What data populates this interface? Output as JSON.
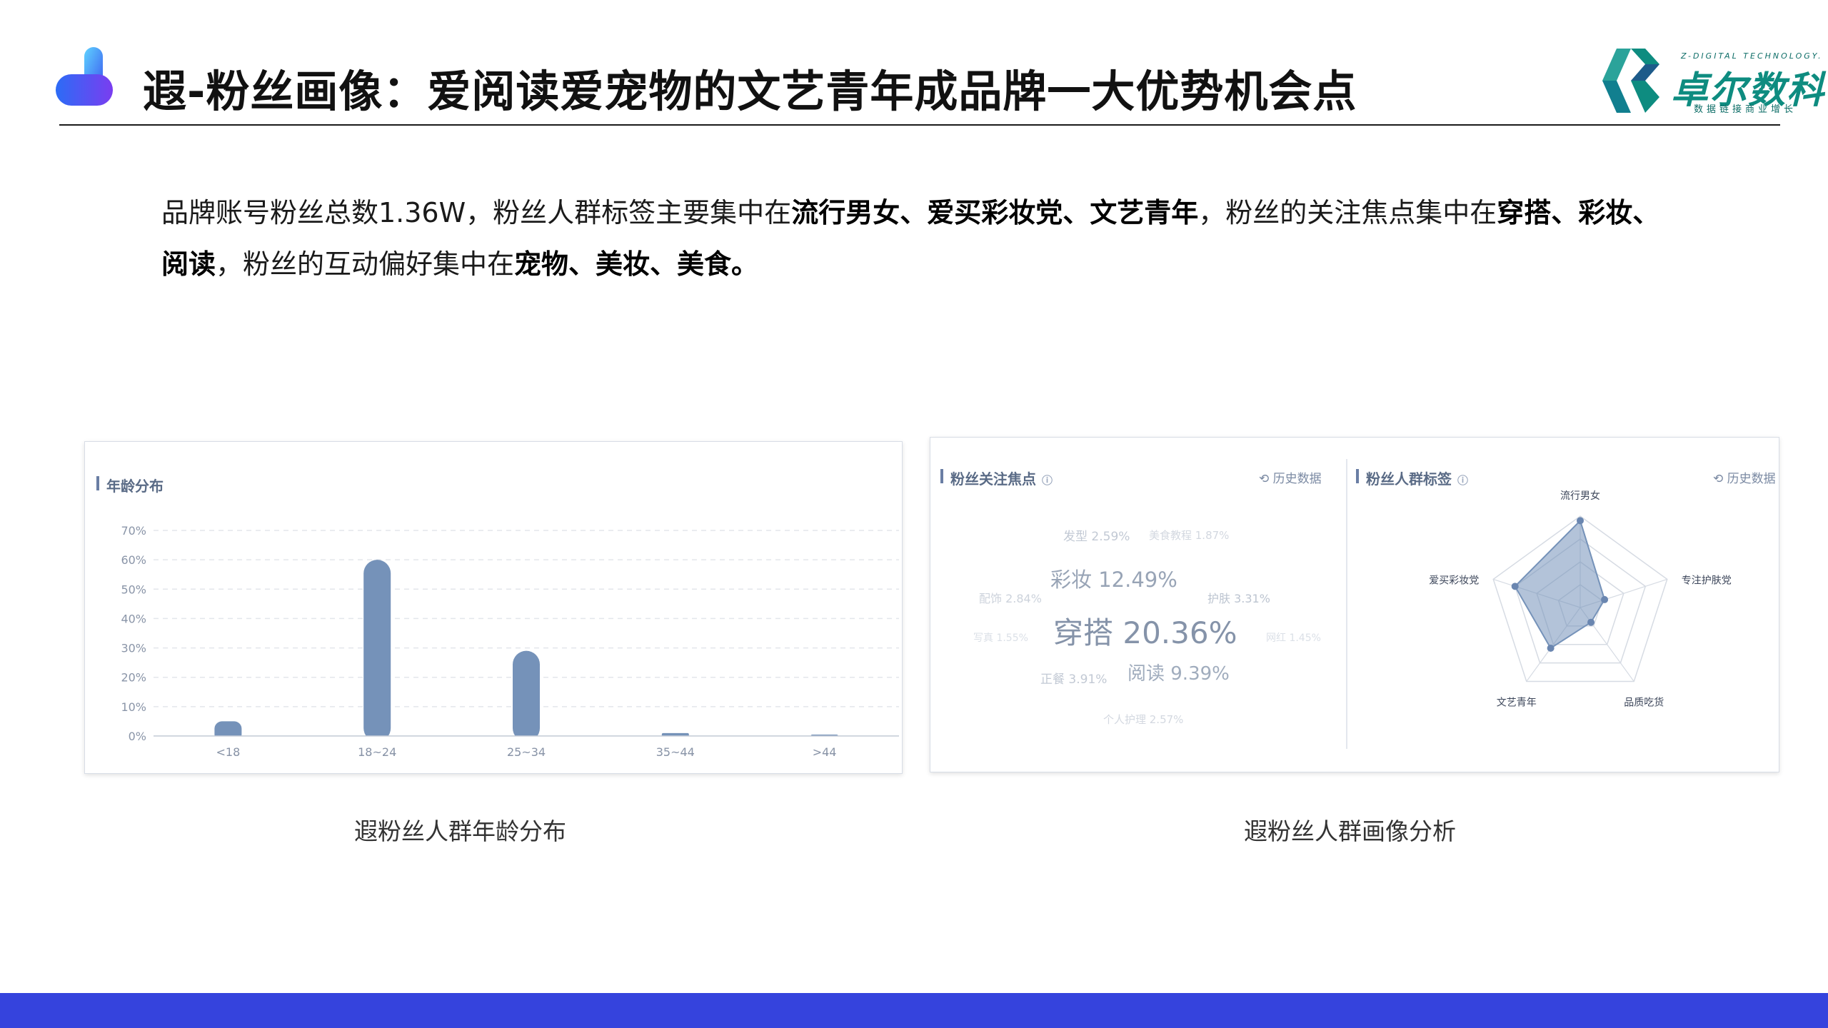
{
  "header": {
    "title": "遐-粉丝画像：爱阅读爱宠物的文艺青年成品牌一大优势机会点",
    "brand": {
      "tagline": "Z-DIGITAL TECHNOLOGY.",
      "name": "卓尔数科",
      "slogan": "数据链接商业增长"
    }
  },
  "description": {
    "s1": "品牌账号粉丝总数1.36W，粉丝人群标签主要集中在",
    "b1": "流行男女、爱买彩妆党、文艺青年",
    "s2": "，粉丝的关注焦点集中在",
    "b2": "穿搭、彩妆、阅读",
    "s3": "，粉丝的互动偏好集中在",
    "b3": "宠物、美妆、美食。"
  },
  "age_panel": {
    "title": "年龄分布",
    "caption": "遐粉丝人群年龄分布"
  },
  "chart_data": {
    "type": "bar",
    "categories": [
      "<18",
      "18~24",
      "25~34",
      "35~44",
      ">44"
    ],
    "values": [
      5,
      60,
      29,
      1,
      0.5
    ],
    "yticks": [
      "0%",
      "10%",
      "20%",
      "30%",
      "40%",
      "50%",
      "60%",
      "70%"
    ],
    "ylim": [
      0,
      70
    ],
    "bar_color": "#7592b9",
    "grid": true
  },
  "fans_panel": {
    "focus_title": "粉丝关注焦点",
    "focus_history": "历史数据",
    "tags_title": "粉丝人群标签",
    "tags_history": "历史数据",
    "caption": "遐粉丝人群画像分析",
    "word_cloud": [
      {
        "id": "w0",
        "text": "发型 2.59%"
      },
      {
        "id": "w1",
        "text": "美食教程 1.87%"
      },
      {
        "id": "w2",
        "text": "彩妆 12.49%"
      },
      {
        "id": "w3",
        "text": "配饰 2.84%"
      },
      {
        "id": "w4",
        "text": "护肤 3.31%"
      },
      {
        "id": "w5",
        "text": "写真 1.55%"
      },
      {
        "id": "w6",
        "text": "穿搭 20.36%"
      },
      {
        "id": "w7",
        "text": "网红 1.45%"
      },
      {
        "id": "w8",
        "text": "正餐 3.91%"
      },
      {
        "id": "w9",
        "text": "阅读 9.39%"
      },
      {
        "id": "w10",
        "text": "个人护理 2.57%"
      }
    ],
    "radar": {
      "labels": [
        "流行男女",
        "专注护肤党",
        "品质吃货",
        "文艺青年",
        "爱买彩妆党"
      ],
      "values": [
        0.95,
        0.28,
        0.2,
        0.55,
        0.75
      ]
    }
  }
}
